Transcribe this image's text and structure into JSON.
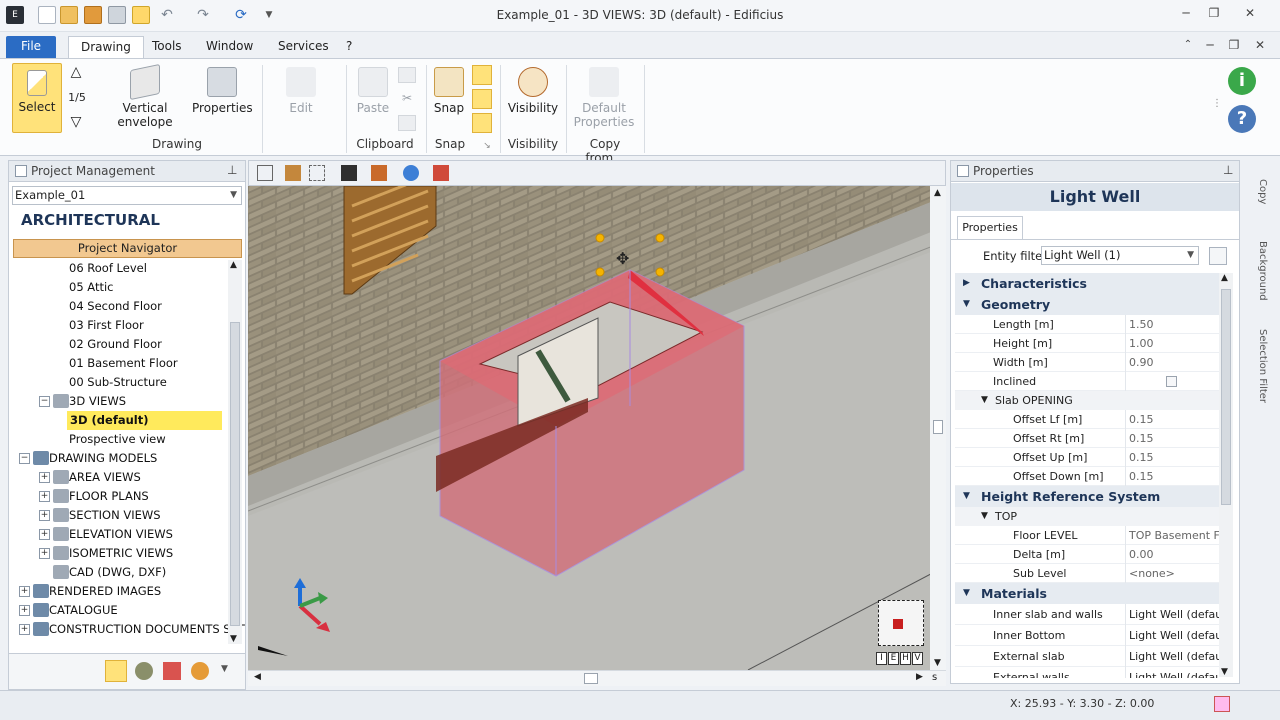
{
  "window": {
    "title": "Example_01 - 3D VIEWS: 3D (default) - Edificius",
    "min": "─",
    "max": "❐",
    "close": "✕"
  },
  "menu": {
    "file": "File",
    "tabs": [
      "Drawing",
      "Tools",
      "Window",
      "Services",
      "?"
    ]
  },
  "ribbon": {
    "select": "Select",
    "level_counter": "1/5",
    "vertical_envelope": "Vertical\nenvelope",
    "properties": "Properties",
    "edit": "Edit",
    "paste": "Paste",
    "snap": "Snap",
    "visibility": "Visibility",
    "default_properties": "Default\nProperties",
    "groups": {
      "drawing": "Drawing",
      "clipboard": "Clipboard",
      "snap": "Snap",
      "visibility": "Visibility",
      "copy_from": "Copy from..."
    }
  },
  "project_management": {
    "header": "Project Management",
    "project": "Example_01",
    "section_title": "ARCHITECTURAL",
    "navigator_label": "Project Navigator",
    "tree": [
      {
        "label": "06 Roof Level",
        "level": 2
      },
      {
        "label": "05 Attic",
        "level": 2
      },
      {
        "label": "04 Second Floor",
        "level": 2
      },
      {
        "label": "03 First Floor",
        "level": 2
      },
      {
        "label": "02 Ground Floor",
        "level": 2
      },
      {
        "label": "01 Basement Floor",
        "level": 2
      },
      {
        "label": "00 Sub-Structure",
        "level": 2
      },
      {
        "label": "3D VIEWS",
        "level": 1,
        "expander": "−"
      },
      {
        "label": "3D (default)",
        "level": 2,
        "selected": true
      },
      {
        "label": "Prospective view",
        "level": 2
      },
      {
        "label": "DRAWING MODELS",
        "level": 0,
        "expander": "−"
      },
      {
        "label": "AREA VIEWS",
        "level": 1,
        "expander": "+"
      },
      {
        "label": "FLOOR PLANS",
        "level": 1,
        "expander": "+"
      },
      {
        "label": "SECTION VIEWS",
        "level": 1,
        "expander": "+"
      },
      {
        "label": "ELEVATION VIEWS",
        "level": 1,
        "expander": "+"
      },
      {
        "label": "ISOMETRIC VIEWS",
        "level": 1,
        "expander": "+"
      },
      {
        "label": "CAD (DWG, DXF)",
        "level": 1
      },
      {
        "label": "RENDERED IMAGES",
        "level": 0,
        "expander": "+"
      },
      {
        "label": "CATALOGUE",
        "level": 0,
        "expander": "+"
      },
      {
        "label": "CONSTRUCTION DOCUMENTS SET",
        "level": 0,
        "expander": "+"
      }
    ]
  },
  "viewcube": {
    "labels": [
      "I",
      "E",
      "H",
      "V"
    ]
  },
  "properties": {
    "header": "Properties",
    "entity_title": "Light Well",
    "tab": "Properties",
    "entity_filter_label": "Entity filter",
    "entity_filter_value": "Light Well (1)",
    "sections": {
      "characteristics": "Characteristics",
      "geometry": "Geometry",
      "height_ref": "Height Reference System",
      "materials": "Materials"
    },
    "geometry": [
      {
        "k": "Length  [m]",
        "v": "1.50"
      },
      {
        "k": "Height  [m]",
        "v": "1.00"
      },
      {
        "k": "Width  [m]",
        "v": "0.90"
      },
      {
        "k": "Inclined",
        "v": ""
      }
    ],
    "slab_opening_label": "Slab OPENING",
    "slab_opening": [
      {
        "k": "Offset Lf  [m]",
        "v": "0.15"
      },
      {
        "k": "Offset Rt  [m]",
        "v": "0.15"
      },
      {
        "k": "Offset Up  [m]",
        "v": "0.15"
      },
      {
        "k": "Offset Down  [m]",
        "v": "0.15"
      }
    ],
    "top_label": "TOP",
    "top": [
      {
        "k": "Floor LEVEL",
        "v": "TOP Basement Floo"
      },
      {
        "k": "Delta  [m]",
        "v": "0.00"
      },
      {
        "k": "Sub Level",
        "v": "<none>"
      }
    ],
    "materials": [
      {
        "k": "Inner slab and walls",
        "v": "Light Well (default)"
      },
      {
        "k": "Inner Bottom",
        "v": "Light Well (default)"
      },
      {
        "k": "External slab",
        "v": "Light Well (default)"
      },
      {
        "k": "External walls",
        "v": "Light Well (default)"
      }
    ]
  },
  "side_tabs": [
    "Copy",
    "Background",
    "Selection Filter"
  ],
  "status": {
    "coords": "X: 25.93 - Y: 3.30 - Z: 0.00"
  },
  "scroll_marker": "s",
  "colors": {
    "accent": "#2b6cc4",
    "selection": "#ffea5c",
    "light_well": "#e0505a"
  }
}
